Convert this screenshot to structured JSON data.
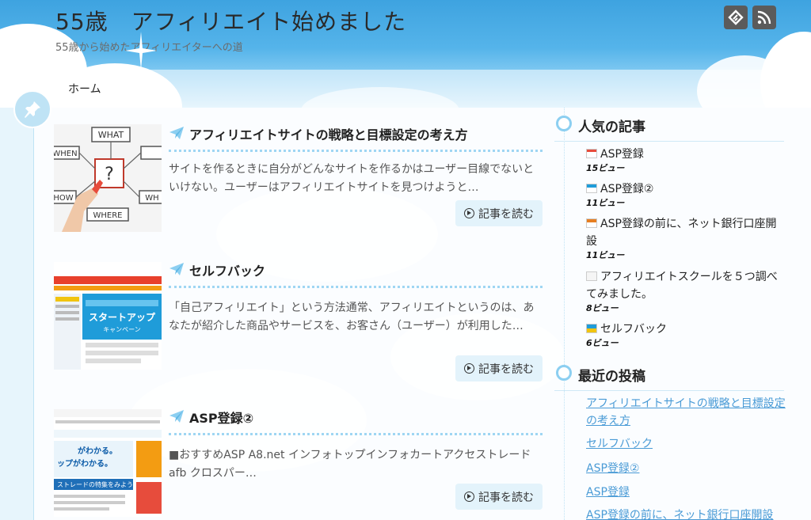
{
  "site": {
    "title": "55歳　アフィリエイト始めました",
    "description": "55歳から始めたアフィリエイターへの道"
  },
  "header_icons": [
    "feedly-icon",
    "rss-icon"
  ],
  "nav": {
    "home_label": "ホーム"
  },
  "posts": [
    {
      "title": "アフィリエイトサイトの戦略と目標設定の考え方",
      "excerpt": "サイトを作るときに自分がどんなサイトを作るかはユーザー目線でないといけない。ユーザーはアフィリエイトサイトを見つけようと…",
      "read_more": "記事を読む"
    },
    {
      "title": "セルフバック",
      "excerpt": "「自己アフィリエイト」という方法通常、アフィリエイトというのは、あなたが紹介した商品やサービスを、お客さん（ユーザー）が利用した…",
      "read_more": "記事を読む"
    },
    {
      "title": "ASP登録②",
      "excerpt": "■おすすめASP A8.net インフォトップインフォカートアクセストレード afb クロスパー…",
      "read_more": "記事を読む"
    }
  ],
  "sidebar": {
    "popular": {
      "title": "人気の記事",
      "items": [
        {
          "label": "ASP登録",
          "views": "15ビュー"
        },
        {
          "label": "ASP登録②",
          "views": "11ビュー"
        },
        {
          "label": "ASP登録の前に、ネット銀行口座開設",
          "views": "11ビュー"
        },
        {
          "label": "アフィリエイトスクールを５つ調べてみました。",
          "views": "8ビュー"
        },
        {
          "label": "セルフバック",
          "views": "6ビュー"
        }
      ]
    },
    "recent": {
      "title": "最近の投稿",
      "items": [
        "アフィリエイトサイトの戦略と目標設定の考え方",
        "セルフバック",
        "ASP登録②",
        "ASP登録",
        "ASP登録の前に、ネット銀行口座開設"
      ]
    }
  },
  "thumb_texts": {
    "what": "WHAT",
    "when": "WHEN",
    "how": "HOW",
    "where": "WHERE",
    "who": "WH",
    "start": "スタートアップ",
    "campaign": "キャンペーン",
    "banner1": "がわかる。",
    "banner2": "ップがわかる。",
    "banner3": "ストレードの特集をみよう!"
  },
  "colors": {
    "sky": "#3ea3e0",
    "accent": "#8ccff1",
    "link": "#4a9bd6"
  }
}
